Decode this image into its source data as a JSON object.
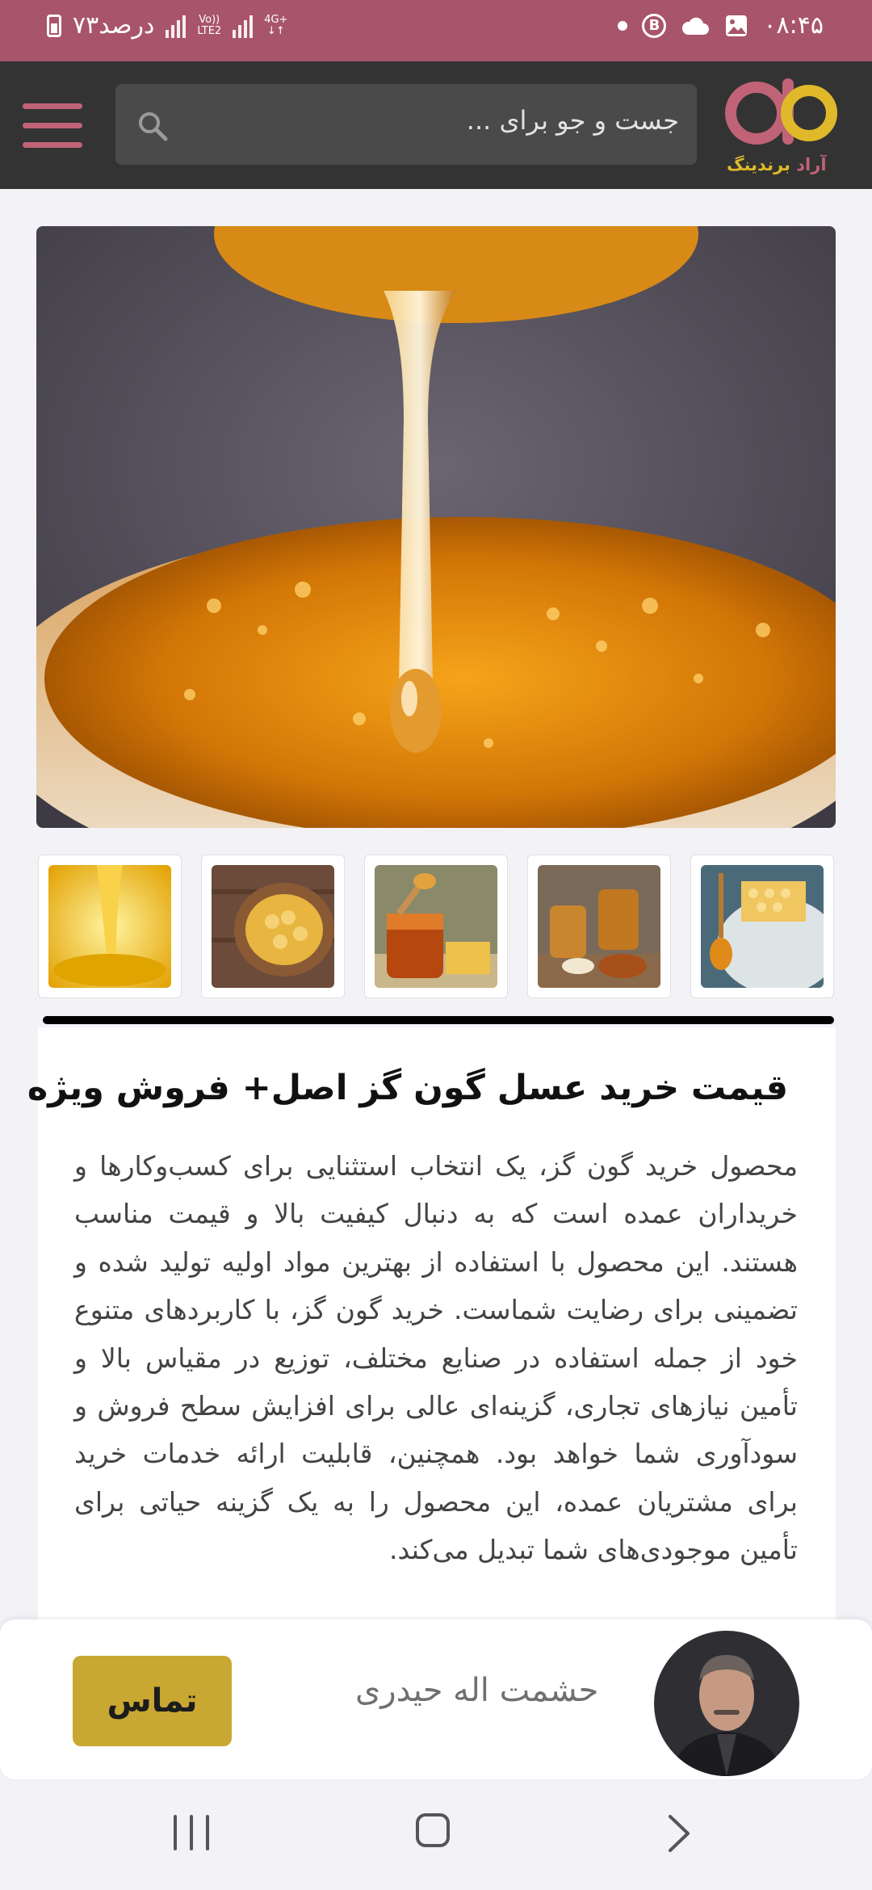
{
  "status_bar": {
    "battery_text": "۷۳درصد",
    "network_top": "Vo))",
    "network_bottom": "LTE2",
    "data_type": "4G+",
    "data_arrows": "↓↑",
    "b_badge": "B",
    "time": "۰۸:۴۵"
  },
  "header": {
    "search_placeholder": "جست و جو برای ...",
    "logo_text": "آراد برندینگ",
    "logo_text_part1": "آراد",
    "logo_text_part2": "برندینگ",
    "accent_color": "#c06377",
    "logo_gold": "#e0b92a"
  },
  "gallery": {
    "main_image": "honey-drip-image",
    "thumbnails": [
      "honey-pour-thumb",
      "honeycomb-bowl-thumb",
      "honey-dipper-jar-thumb",
      "honey-jars-thumb",
      "honeycomb-spoon-thumb"
    ]
  },
  "article": {
    "title": "قیمت خرید عسل گون گز اصل+ فروش ویژه",
    "body": "محصول خرید گون گز، یک انتخاب استثنایی برای کسب‌وکارها و خریداران عمده است که به دنبال کیفیت بالا و قیمت مناسب هستند. این محصول با استفاده از بهترین مواد اولیه تولید شده و تضمینی برای رضایت شماست. خرید گون گز، با کاربردهای متنوع خود از جمله استفاده در صنایع مختلف، توزیع در مقیاس بالا و تأمین نیازهای تجاری، گزینه‌ای عالی برای افزایش سطح فروش و سودآوری شما خواهد بود. همچنین، قابلیت ارائه خدمات خرید برای مشتریان عمده، این محصول را به یک گزینه حیاتی برای تأمین موجودی‌های شما تبدیل می‌کند."
  },
  "contact": {
    "agent_name": "حشمت اله حیدری",
    "call_label": "تماس",
    "call_color": "#c8a732"
  },
  "colors": {
    "status_bar": "#a8546a",
    "header_bg": "#333333"
  }
}
